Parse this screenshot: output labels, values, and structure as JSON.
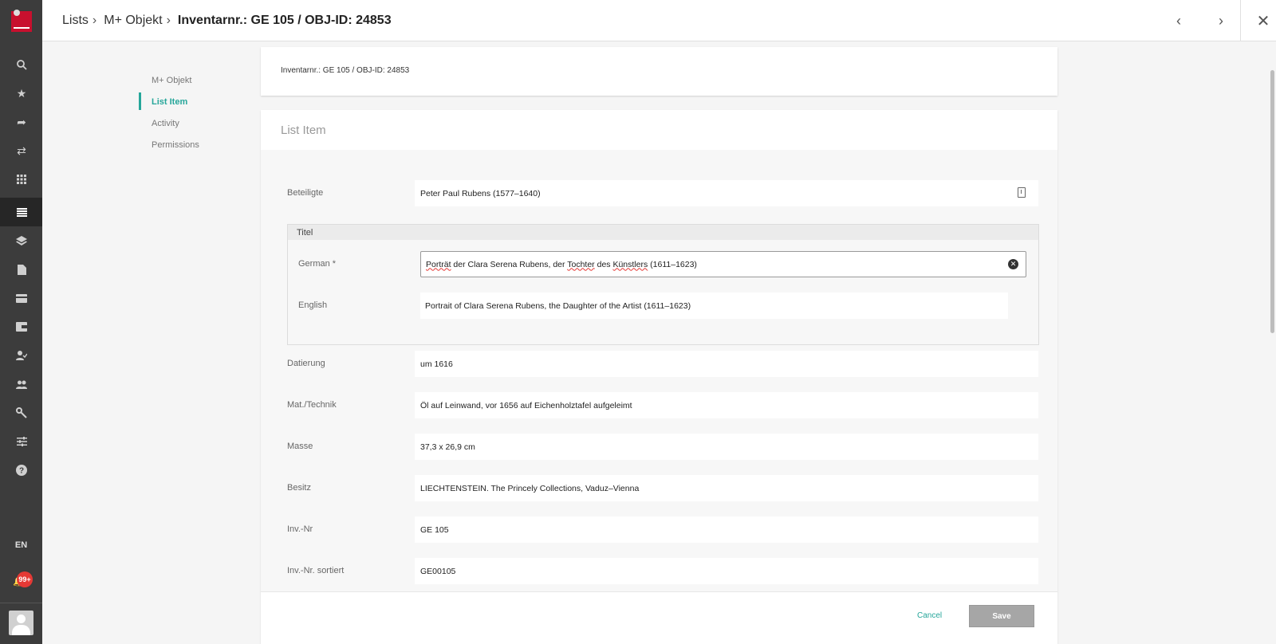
{
  "rail": {
    "icons": [
      "search-icon",
      "star-icon",
      "share-icon",
      "swap-icon",
      "apps-grid-icon",
      "list-icon",
      "layers-icon",
      "document-icon",
      "card-icon",
      "wallet-icon",
      "user-check-icon",
      "group-icon",
      "key-icon",
      "tune-icon",
      "help-icon"
    ],
    "language": "EN",
    "notification_count": "99+"
  },
  "breadcrumb": {
    "items": [
      "Lists",
      "M+ Objekt"
    ],
    "current": "Inventarnr.: GE 105 / OBJ-ID: 24853"
  },
  "subnav": {
    "items": [
      "M+ Objekt",
      "List Item",
      "Activity",
      "Permissions"
    ],
    "active": "List Item"
  },
  "summary": {
    "text": "Inventarnr.: GE 105 / OBJ-ID: 24853"
  },
  "form": {
    "section_title": "List Item",
    "beteiligte": {
      "label": "Beteiligte",
      "value": "Peter Paul Rubens (1577–1640)"
    },
    "titel": {
      "label": "Titel",
      "german": {
        "label": "German *",
        "value_parts": [
          "Porträt",
          " der Clara Serena Rubens, der ",
          "Tochter",
          " des ",
          "Künstlers",
          " (1611–1623)"
        ]
      },
      "english": {
        "label": "English",
        "value": "Portrait of Clara Serena Rubens, the Daughter of the Artist (1611–1623)"
      }
    },
    "fields": [
      {
        "label": "Datierung",
        "value": "um 1616"
      },
      {
        "label": "Mat./Technik",
        "value": "Öl auf Leinwand, vor 1656 auf Eichenholztafel aufgeleimt"
      },
      {
        "label": "Masse",
        "value": "37,3 x 26,9 cm"
      },
      {
        "label": "Besitz",
        "value": "LIECHTENSTEIN. The Princely Collections, Vaduz–Vienna"
      },
      {
        "label": "Inv.-Nr",
        "value": "GE 105"
      },
      {
        "label": "Inv.-Nr. sortiert",
        "value": "GE00105"
      }
    ]
  },
  "footer": {
    "cancel_label": "Cancel",
    "save_label": "Save"
  }
}
